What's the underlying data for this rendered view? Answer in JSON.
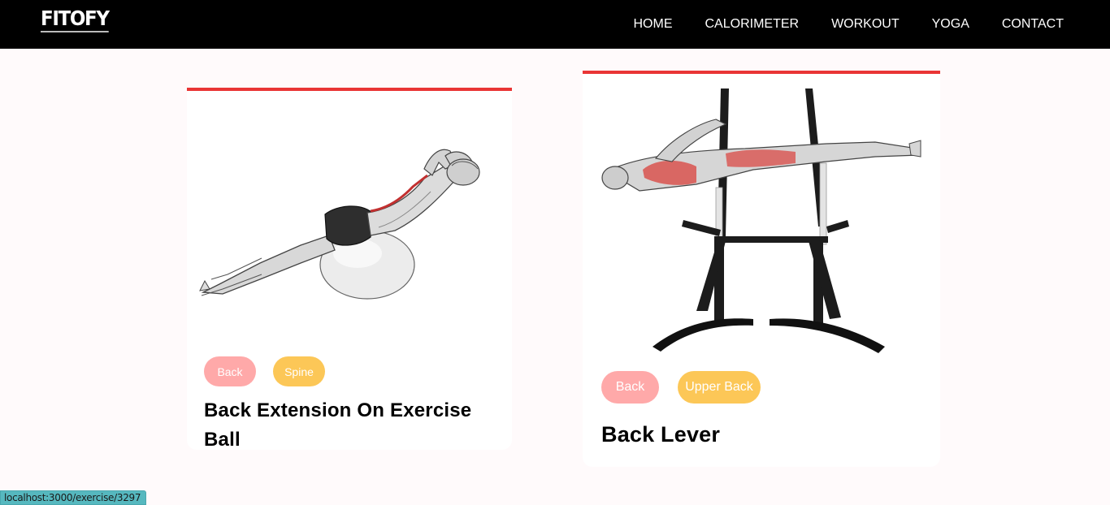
{
  "navbar": {
    "logo": "FITOFY",
    "links": [
      "HOME",
      "CALORIMETER",
      "WORKOUT",
      "YOGA",
      "CONTACT"
    ]
  },
  "exercises": [
    {
      "title": "Back Extension On Exercise Ball",
      "tags": [
        "Back",
        "Spine"
      ],
      "image_alt": "back-extension-illustration"
    },
    {
      "title": "Back Lever",
      "tags": [
        "Back",
        "Upper Back"
      ],
      "image_alt": "back-lever-illustration"
    }
  ],
  "status_bar": {
    "url": "localhost:3000/exercise/3297"
  },
  "colors": {
    "navbar": "#000000",
    "accent": "#e93535",
    "badge_primary": "#ffa9a9",
    "badge_secondary": "#fcc757",
    "page_background": "#fffafb"
  }
}
